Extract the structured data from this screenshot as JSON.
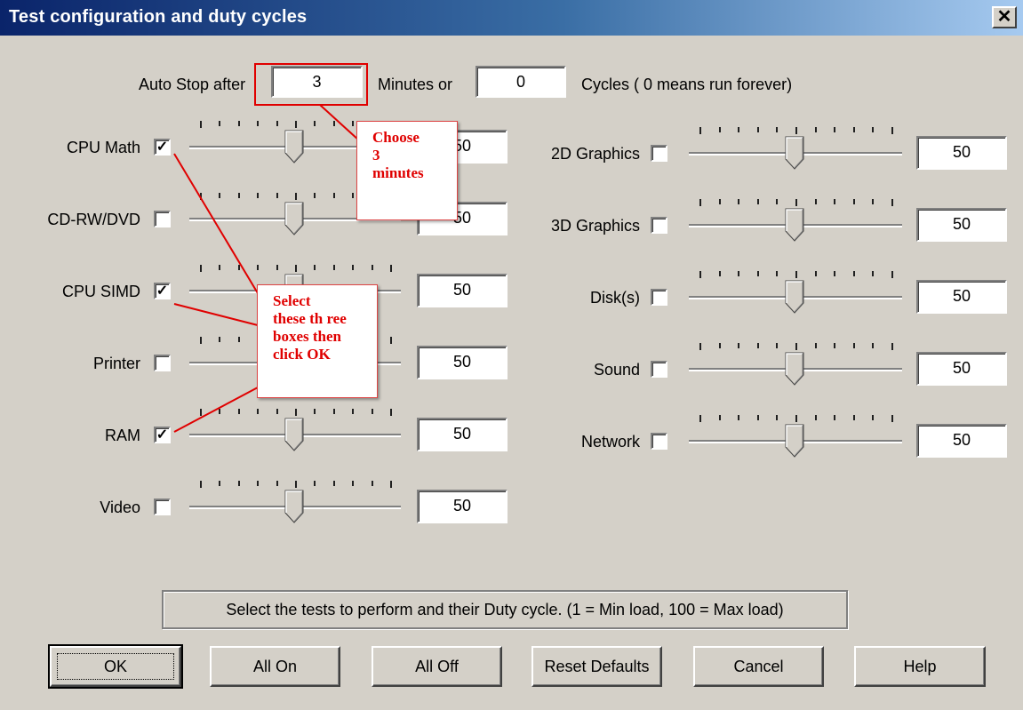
{
  "window": {
    "title": "Test configuration and duty cycles",
    "close_glyph": "✕"
  },
  "autostop": {
    "label": "Auto Stop after",
    "minutes_value": "3",
    "minutes_label": "Minutes or",
    "cycles_value": "0",
    "cycles_label": "Cycles ( 0 means run forever)"
  },
  "tests_left": [
    {
      "label": "CPU Math",
      "checked": true,
      "slider_value": 50,
      "value": "50"
    },
    {
      "label": "CD-RW/DVD",
      "checked": false,
      "slider_value": 50,
      "value": "50"
    },
    {
      "label": "CPU SIMD",
      "checked": true,
      "slider_value": 50,
      "value": "50"
    },
    {
      "label": "Printer",
      "checked": false,
      "slider_value": 50,
      "value": "50"
    },
    {
      "label": "RAM",
      "checked": true,
      "slider_value": 50,
      "value": "50"
    },
    {
      "label": "Video",
      "checked": false,
      "slider_value": 50,
      "value": "50"
    }
  ],
  "tests_right": [
    {
      "label": "2D Graphics",
      "checked": false,
      "slider_value": 50,
      "value": "50"
    },
    {
      "label": "3D Graphics",
      "checked": false,
      "slider_value": 50,
      "value": "50"
    },
    {
      "label": "Disk(s)",
      "checked": false,
      "slider_value": 50,
      "value": "50"
    },
    {
      "label": "Sound",
      "checked": false,
      "slider_value": 50,
      "value": "50"
    },
    {
      "label": "Network",
      "checked": false,
      "slider_value": 50,
      "value": "50"
    }
  ],
  "status_text": "Select the tests to perform and their Duty cycle. (1 = Min load, 100 = Max load)",
  "buttons": {
    "ok": "OK",
    "all_on": "All On",
    "all_off": "All Off",
    "reset": "Reset Defaults",
    "cancel": "Cancel",
    "help": "Help"
  },
  "annotations": {
    "choose": [
      "Choose",
      "3",
      "minutes"
    ],
    "select": [
      "Select",
      "these th ree",
      "boxes then",
      "click OK"
    ]
  },
  "colors": {
    "annotation": "#e00000",
    "dialog_bg": "#d4d0c8",
    "title_start": "#0a246a",
    "title_end": "#a6caf0"
  }
}
